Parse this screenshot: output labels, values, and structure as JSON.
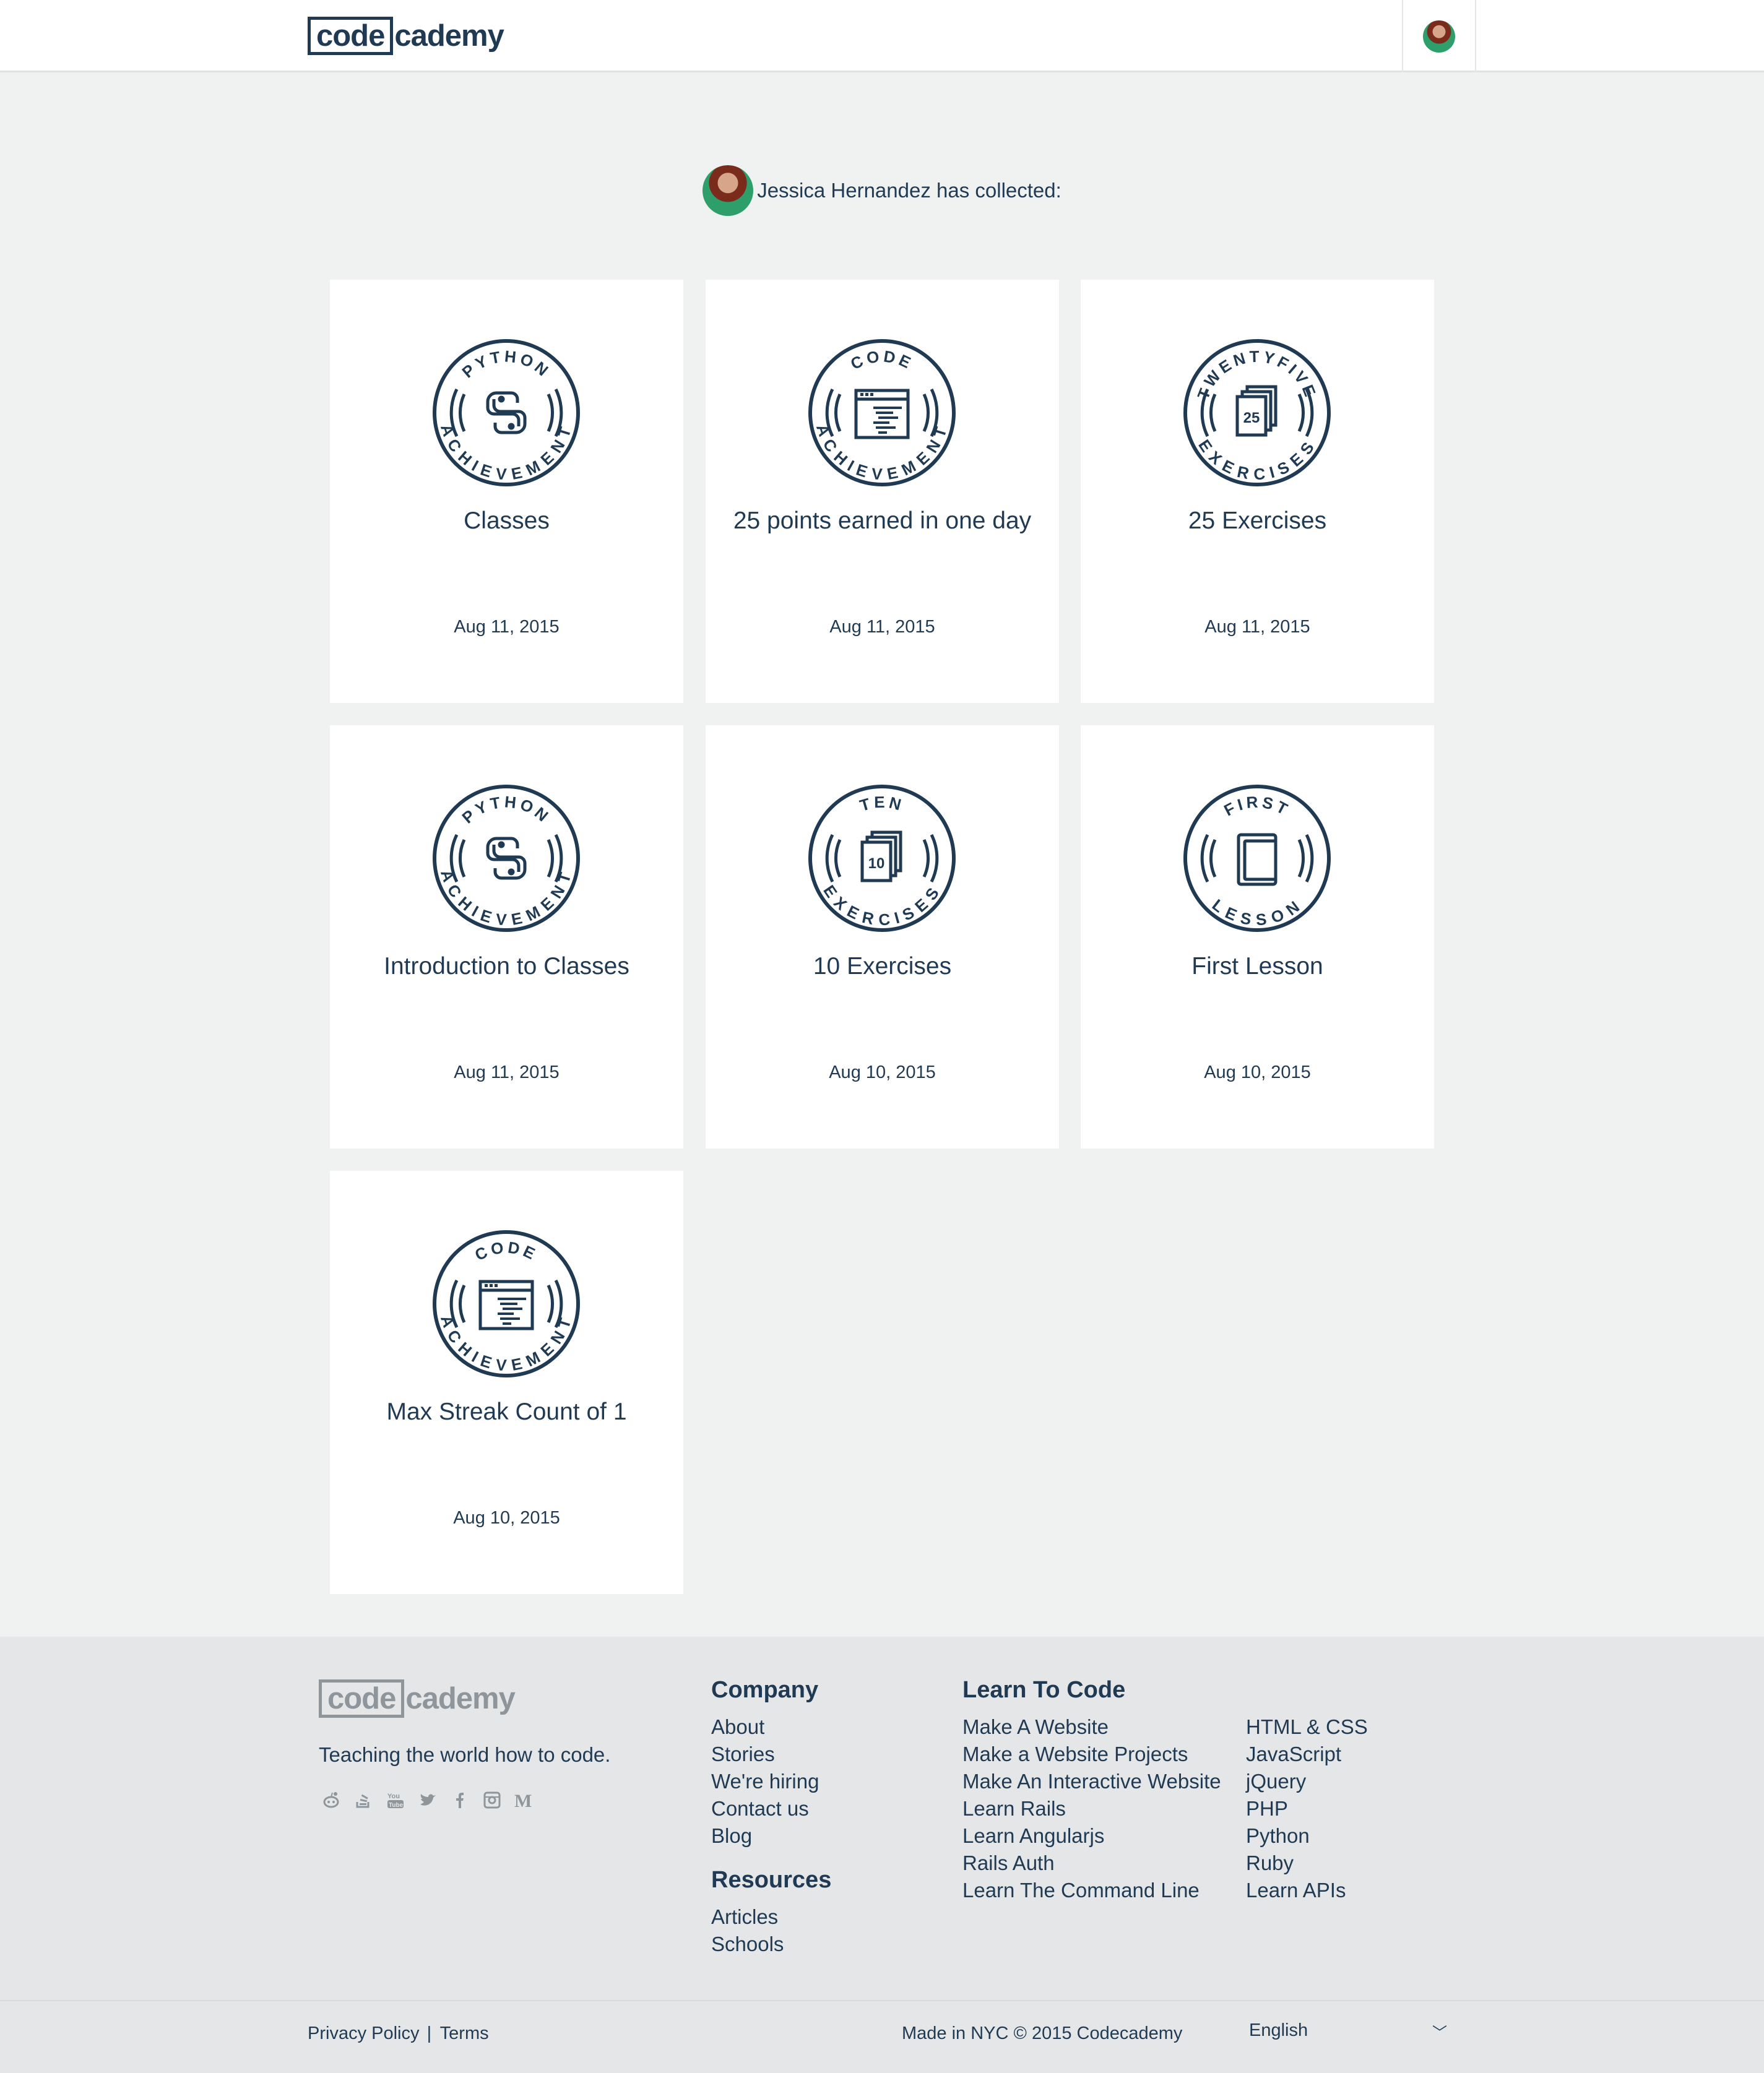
{
  "header": {
    "logo_boxed": "code",
    "logo_rest": "cademy",
    "avatar_alt": "user-avatar"
  },
  "profile": {
    "name": "Jessica Hernandez",
    "collected_suffix": " has collected:"
  },
  "badges": [
    {
      "ring_top": "PYTHON",
      "ring_bottom": "ACHIEVEMENT",
      "icon": "python-icon",
      "title": "Classes",
      "date": "Aug 11, 2015"
    },
    {
      "ring_top": "CODE",
      "ring_bottom": "ACHIEVEMENT",
      "icon": "code-window-icon",
      "title": "25 points earned in one day",
      "date": "Aug 11, 2015"
    },
    {
      "ring_top": "TWENTYFIVE",
      "ring_bottom": "EXERCISES",
      "icon": "pages-icon",
      "number": "25",
      "title": "25 Exercises",
      "date": "Aug 11, 2015"
    },
    {
      "ring_top": "PYTHON",
      "ring_bottom": "ACHIEVEMENT",
      "icon": "python-icon",
      "title": "Introduction to Classes",
      "date": "Aug 11, 2015"
    },
    {
      "ring_top": "TEN",
      "ring_bottom": "EXERCISES",
      "icon": "pages-icon",
      "number": "10",
      "title": "10 Exercises",
      "date": "Aug 10, 2015"
    },
    {
      "ring_top": "FIRST",
      "ring_bottom": "LESSON",
      "icon": "book-icon",
      "title": "First Lesson",
      "date": "Aug 10, 2015"
    },
    {
      "ring_top": "CODE",
      "ring_bottom": "ACHIEVEMENT",
      "icon": "code-window-icon",
      "title": "Max Streak Count of 1",
      "date": "Aug 10, 2015"
    }
  ],
  "footer": {
    "logo_boxed": "code",
    "logo_rest": "cademy",
    "tagline": "Teaching the world how to code.",
    "social_icons": [
      "reddit-icon",
      "stackoverflow-icon",
      "youtube-icon",
      "twitter-icon",
      "facebook-icon",
      "instagram-icon",
      "medium-icon"
    ],
    "company": {
      "heading": "Company",
      "links": [
        "About",
        "Stories",
        "We're hiring",
        "Contact us",
        "Blog"
      ]
    },
    "resources": {
      "heading": "Resources",
      "links": [
        "Articles",
        "Schools"
      ]
    },
    "learn": {
      "heading": "Learn To Code",
      "col1": [
        "Make A Website",
        "Make a Website Projects",
        "Make An Interactive Website",
        "Learn Rails",
        "Learn Angularjs",
        "Rails Auth",
        "Learn The Command Line"
      ],
      "col2": [
        "HTML & CSS",
        "JavaScript",
        "jQuery",
        "PHP",
        "Python",
        "Ruby",
        "Learn APIs"
      ]
    },
    "privacy": "Privacy Policy",
    "separator": "|",
    "terms": "Terms",
    "made_in": "Made in NYC © 2015 Codecademy",
    "language": "English",
    "language_caret": "﹀"
  },
  "colors": {
    "navy": "#1f3a52",
    "page_bg": "#f0f1f1",
    "footer_bg": "#e5e6e8",
    "muted_gray": "#8e969c"
  }
}
